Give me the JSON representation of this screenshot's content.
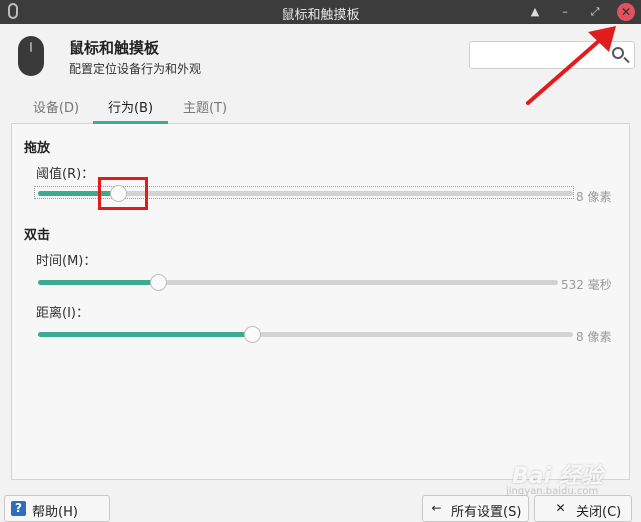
{
  "window": {
    "title": "鼠标和触摸板",
    "controls": {
      "minimize": "▲",
      "restore": "–",
      "maximize": "⤢",
      "close": "✕"
    }
  },
  "header": {
    "title": "鼠标和触摸板",
    "subtitle": "配置定位设备行为和外观",
    "search_placeholder": ""
  },
  "tabs": [
    {
      "label": "设备(D)",
      "active": false
    },
    {
      "label": "行为(B)",
      "active": true
    },
    {
      "label": "主题(T)",
      "active": false
    }
  ],
  "drag": {
    "section_label": "拖放",
    "threshold": {
      "label": "阈值(R)：",
      "value_text": "8 像素",
      "fraction": 0.15
    }
  },
  "double_click": {
    "section_label": "双击",
    "time": {
      "label": "时间(M)：",
      "value_text": "532 毫秒",
      "fraction": 0.23
    },
    "distance": {
      "label": "距离(I)：",
      "value_text": "8 像素",
      "fraction": 0.4
    }
  },
  "footer": {
    "help_label": "帮助(H)",
    "help_icon": "?",
    "all_settings_label": "所有设置(S)",
    "all_settings_icon": "←",
    "close_label": "关闭(C)",
    "close_icon": "✕"
  },
  "watermark": {
    "logo_text": "Bai 经验",
    "sub_text": "jingyan.baidu.com"
  },
  "colors": {
    "accent": "#3cab8e",
    "highlight": "#e21c1c",
    "titlebar": "#3c3c3c"
  }
}
